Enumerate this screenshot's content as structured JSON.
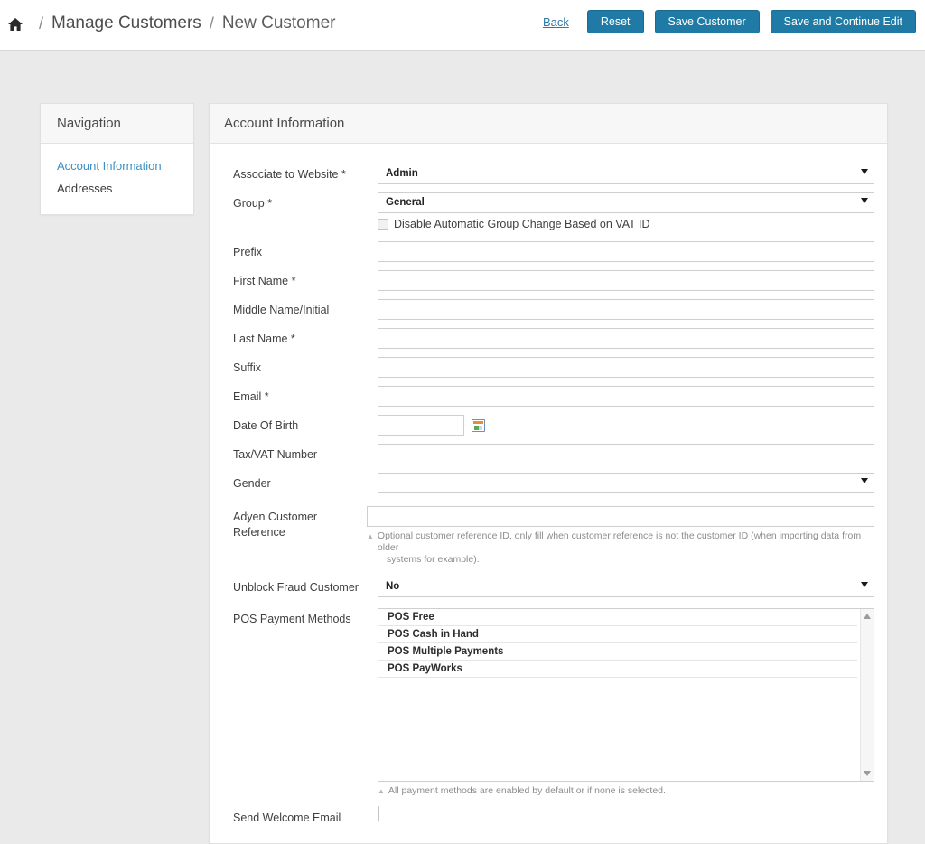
{
  "topbar": {
    "home_icon": "home-icon",
    "separator": "/",
    "breadcrumb": [
      "Manage Customers",
      "New Customer"
    ],
    "back_label": "Back",
    "buttons": [
      {
        "label": "Reset",
        "name": "reset-button"
      },
      {
        "label": "Save Customer",
        "name": "save-customer-button"
      },
      {
        "label": "Save and Continue Edit",
        "name": "save-and-continue-edit-button"
      }
    ],
    "accent_color": "#1f7ba5",
    "link_color": "#2b7aa8"
  },
  "sidebar": {
    "title": "Navigation",
    "items": [
      {
        "label": "Account Information",
        "active": true
      },
      {
        "label": "Addresses",
        "active": false
      }
    ],
    "active_color": "#3b8ec2"
  },
  "panel": {
    "title": "Account Information",
    "fields": {
      "associate_to_website": {
        "label": "Associate to Website *",
        "value": "Admin"
      },
      "group": {
        "label": "Group *",
        "value": "General",
        "checkbox_label": "Disable Automatic Group Change Based on VAT ID",
        "checkbox_checked": false
      },
      "prefix": {
        "label": "Prefix",
        "value": ""
      },
      "first_name": {
        "label": "First Name *",
        "value": ""
      },
      "middle_name": {
        "label": "Middle Name/Initial",
        "value": ""
      },
      "last_name": {
        "label": "Last Name *",
        "value": ""
      },
      "suffix": {
        "label": "Suffix",
        "value": ""
      },
      "email": {
        "label": "Email *",
        "value": ""
      },
      "date_of_birth": {
        "label": "Date Of Birth",
        "value": "",
        "calendar_icon": "calendar-icon"
      },
      "tax_vat_number": {
        "label": "Tax/VAT Number",
        "value": ""
      },
      "gender": {
        "label": "Gender",
        "value": ""
      },
      "adyen_customer_reference": {
        "label": "Adyen Customer Reference",
        "value": "",
        "note_line1": "Optional customer reference ID, only fill when customer reference is not the customer ID (when importing data from older",
        "note_line2": "systems for example)."
      },
      "unblock_fraud_customer": {
        "label": "Unblock Fraud Customer",
        "value": "No"
      },
      "pos_payment_methods": {
        "label": "POS Payment Methods",
        "options": [
          "POS Free",
          "POS Cash in Hand",
          "POS Multiple Payments",
          "POS PayWorks"
        ],
        "note": "All payment methods are enabled by default or if none is selected."
      },
      "send_welcome_email": {
        "label": "Send Welcome Email",
        "checked": false
      }
    }
  }
}
